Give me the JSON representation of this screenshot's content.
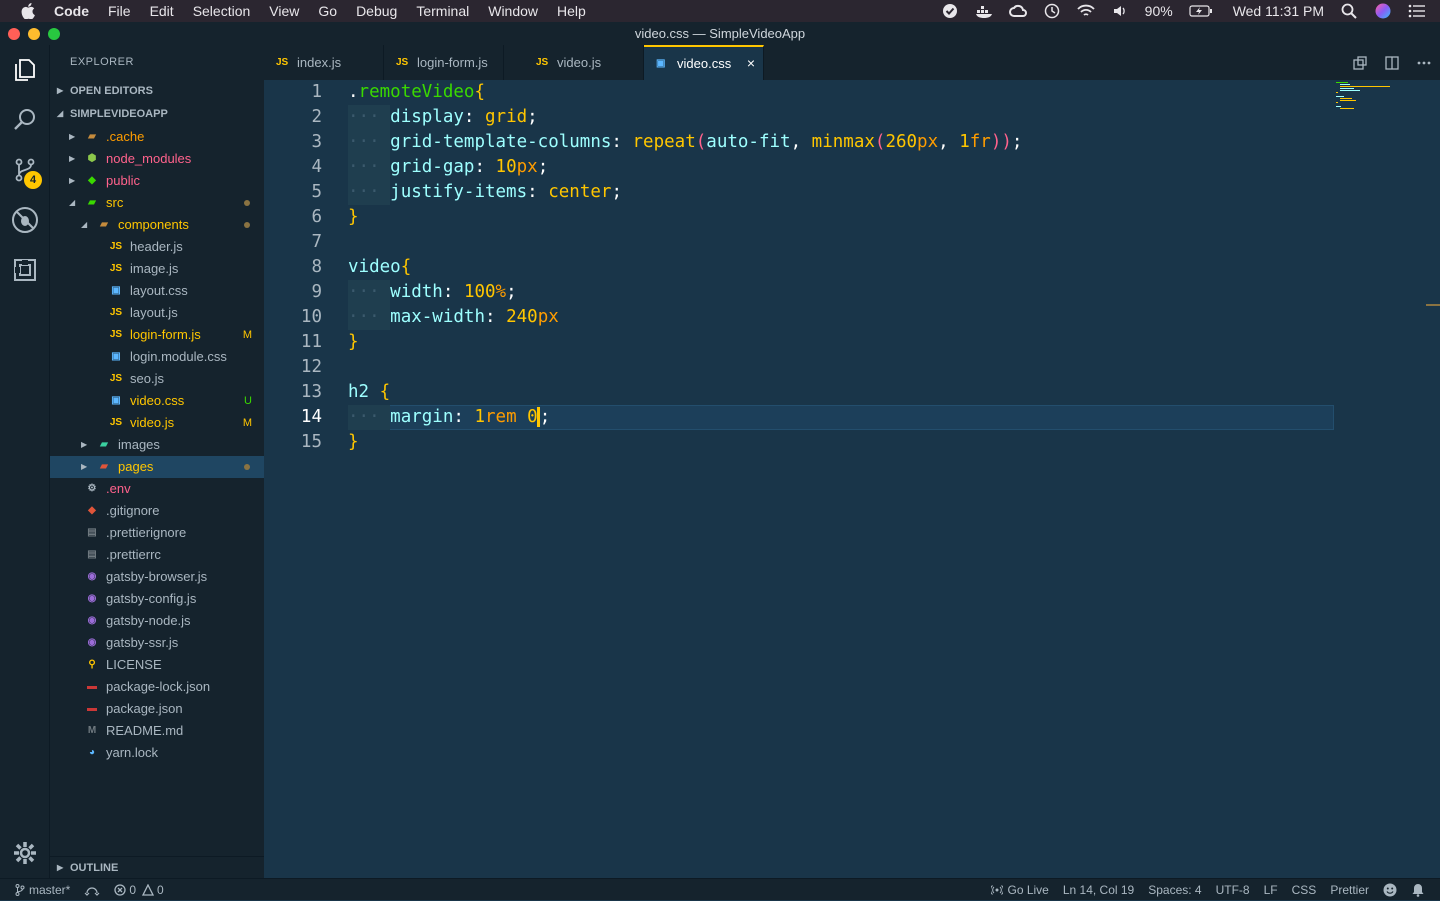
{
  "menubar": {
    "items": [
      "Code",
      "File",
      "Edit",
      "Selection",
      "View",
      "Go",
      "Debug",
      "Terminal",
      "Window",
      "Help"
    ],
    "battery": "90%",
    "clock": "Wed 11:31 PM"
  },
  "window": {
    "title": "video.css — SimpleVideoApp"
  },
  "activity": {
    "scm_badge": "4"
  },
  "sidebar": {
    "title": "EXPLORER",
    "open_editors": "OPEN EDITORS",
    "project": "SIMPLEVIDEOAPP",
    "outline": "OUTLINE",
    "tree": [
      {
        "label": ".cache",
        "icon": "folder-icon",
        "color": "#ff9d00",
        "status": ""
      },
      {
        "label": "node_modules",
        "icon": "node-folder-icon",
        "color": "#ff628c",
        "status": ""
      },
      {
        "label": "public",
        "icon": "public-folder-icon",
        "color": "#ff628c",
        "status": ""
      },
      {
        "label": "src",
        "icon": "src-folder-icon",
        "color": "#ffc600",
        "status": ""
      },
      {
        "label": "components",
        "icon": "components-folder-icon",
        "color": "#ffc600",
        "status": ""
      },
      {
        "label": "header.js",
        "icon": "js-icon",
        "color": "#aab7c1",
        "status": ""
      },
      {
        "label": "image.js",
        "icon": "js-icon",
        "color": "#aab7c1",
        "status": ""
      },
      {
        "label": "layout.css",
        "icon": "css-icon",
        "color": "#aab7c1",
        "status": ""
      },
      {
        "label": "layout.js",
        "icon": "js-icon",
        "color": "#aab7c1",
        "status": ""
      },
      {
        "label": "login-form.js",
        "icon": "js-icon",
        "color": "#ffc600",
        "status": "M"
      },
      {
        "label": "login.module.css",
        "icon": "css-icon",
        "color": "#aab7c1",
        "status": ""
      },
      {
        "label": "seo.js",
        "icon": "js-icon",
        "color": "#aab7c1",
        "status": ""
      },
      {
        "label": "video.css",
        "icon": "css-icon",
        "color": "#ffc600",
        "status": "U"
      },
      {
        "label": "video.js",
        "icon": "js-icon",
        "color": "#ffc600",
        "status": "M"
      },
      {
        "label": "images",
        "icon": "images-folder-icon",
        "color": "#aab7c1",
        "status": ""
      },
      {
        "label": "pages",
        "icon": "pages-folder-icon",
        "color": "#ffc600",
        "status": ""
      },
      {
        "label": ".env",
        "icon": "gear-icon",
        "color": "#ff628c",
        "status": ""
      },
      {
        "label": ".gitignore",
        "icon": "git-icon",
        "color": "#aab7c1",
        "status": ""
      },
      {
        "label": ".prettierignore",
        "icon": "prettier-icon",
        "color": "#aab7c1",
        "status": ""
      },
      {
        "label": ".prettierrc",
        "icon": "prettier-icon",
        "color": "#aab7c1",
        "status": ""
      },
      {
        "label": "gatsby-browser.js",
        "icon": "gatsby-icon",
        "color": "#aab7c1",
        "status": ""
      },
      {
        "label": "gatsby-config.js",
        "icon": "gatsby-icon",
        "color": "#aab7c1",
        "status": ""
      },
      {
        "label": "gatsby-node.js",
        "icon": "gatsby-icon",
        "color": "#aab7c1",
        "status": ""
      },
      {
        "label": "gatsby-ssr.js",
        "icon": "gatsby-icon",
        "color": "#aab7c1",
        "status": ""
      },
      {
        "label": "LICENSE",
        "icon": "license-icon",
        "color": "#aab7c1",
        "status": ""
      },
      {
        "label": "package-lock.json",
        "icon": "npm-icon",
        "color": "#aab7c1",
        "status": ""
      },
      {
        "label": "package.json",
        "icon": "npm-icon",
        "color": "#aab7c1",
        "status": ""
      },
      {
        "label": "README.md",
        "icon": "markdown-icon",
        "color": "#aab7c1",
        "status": ""
      },
      {
        "label": "yarn.lock",
        "icon": "yarn-icon",
        "color": "#aab7c1",
        "status": ""
      }
    ]
  },
  "tabs": [
    {
      "label": "index.js",
      "icon": "JS"
    },
    {
      "label": "login-form.js",
      "icon": "JS"
    },
    {
      "label": "video.js",
      "icon": "JS"
    },
    {
      "label": "video.css",
      "icon": "CSS",
      "close": "×"
    }
  ],
  "editor": {
    "line_numbers": [
      "1",
      "2",
      "3",
      "4",
      "5",
      "6",
      "7",
      "8",
      "9",
      "10",
      "11",
      "12",
      "13",
      "14",
      "15"
    ]
  },
  "status": {
    "branch": "master*",
    "errors": "0",
    "warnings": "0",
    "go_live": "Go Live",
    "position": "Ln 14, Col 19",
    "spaces": "Spaces: 4",
    "encoding": "UTF-8",
    "eol": "LF",
    "language": "CSS",
    "formatter": "Prettier"
  },
  "colors": {
    "accent": "#ffc600",
    "background": "#193549",
    "sidebar": "#15232d"
  }
}
